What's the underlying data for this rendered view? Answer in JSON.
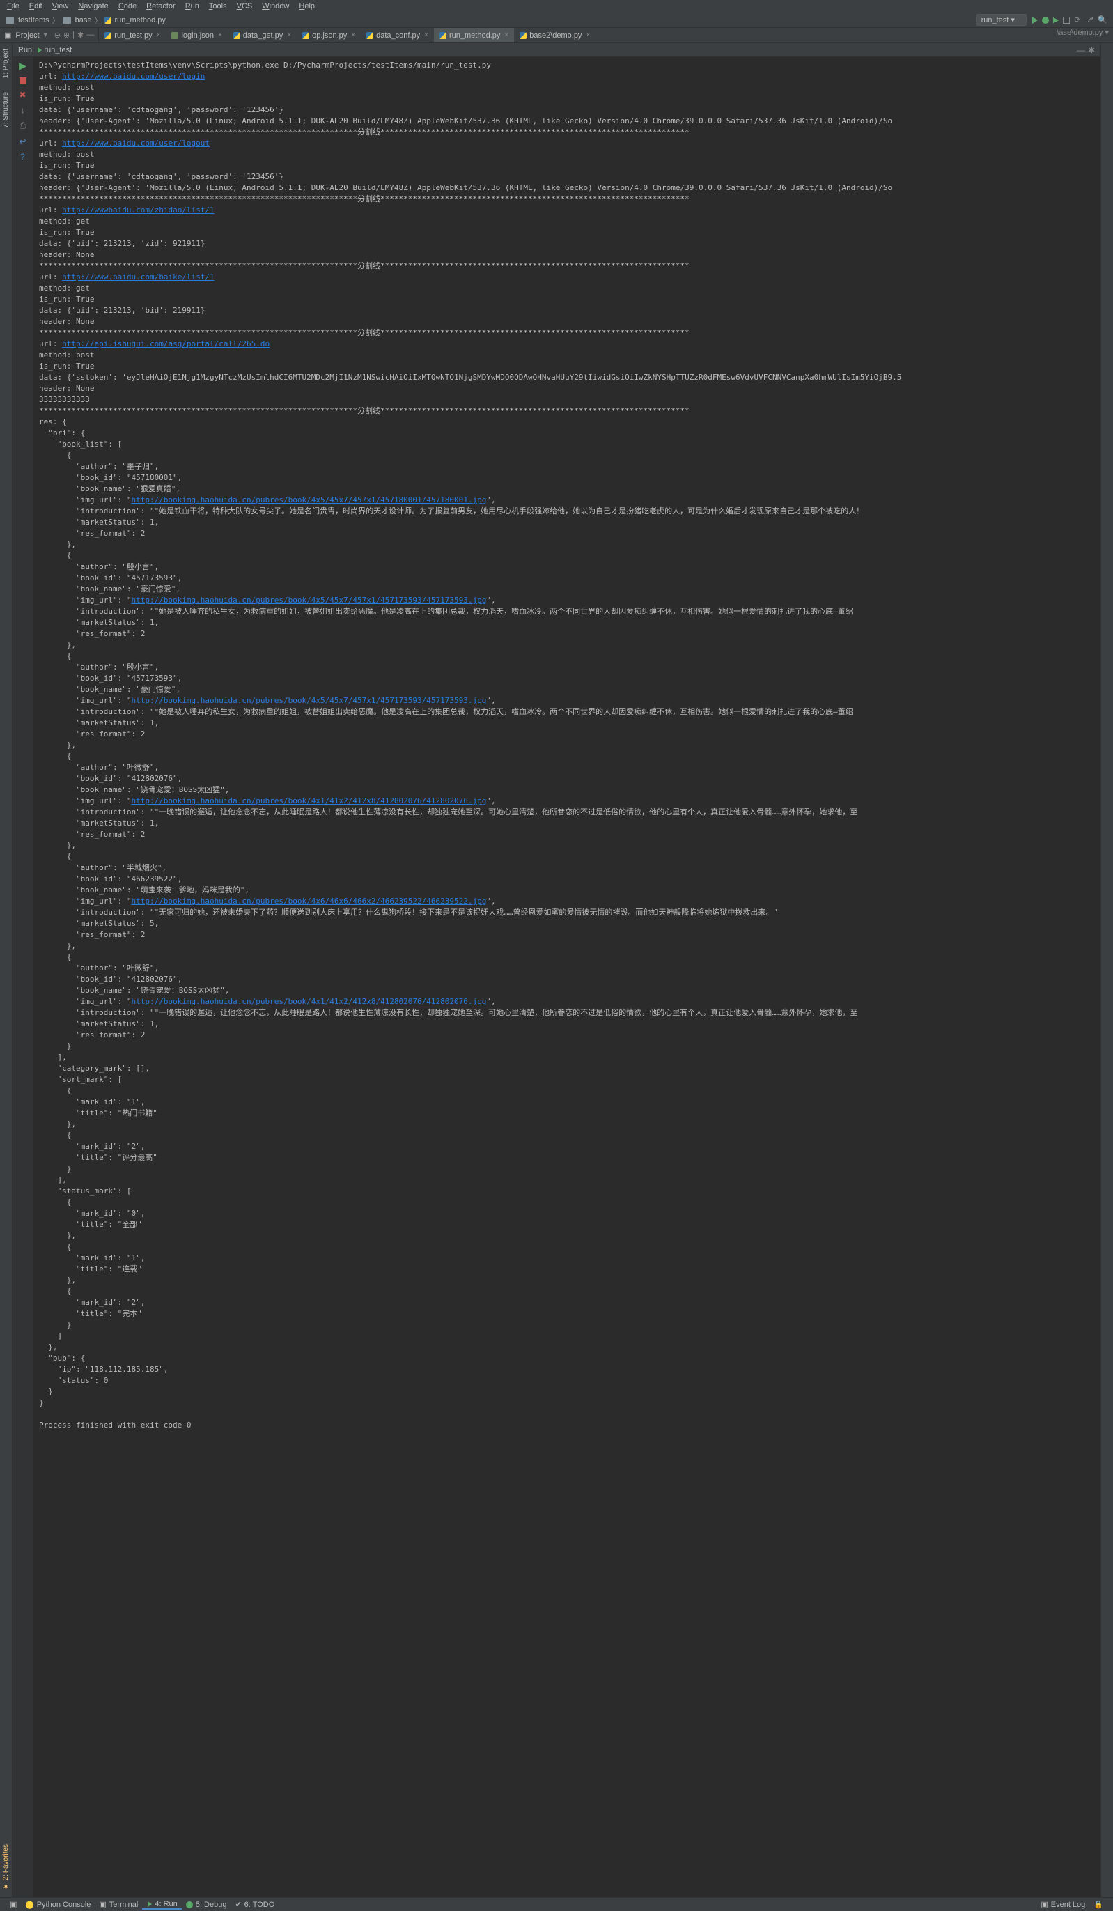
{
  "menu": [
    "File",
    "Edit",
    "View",
    "Navigate",
    "Code",
    "Refactor",
    "Run",
    "Tools",
    "VCS",
    "Window",
    "Help"
  ],
  "breadcrumb": {
    "root": "testItems",
    "folder": "base",
    "file": "run_method.py"
  },
  "runConfig": "run_test",
  "navPath": "\\ase\\demo.py",
  "sideTools": {
    "project": "1: Project",
    "structure": "7: Structure",
    "favorites": "2: Favorites"
  },
  "projHeader": "Project",
  "tabs": [
    {
      "type": "py",
      "name": "run_test.py",
      "close": true
    },
    {
      "type": "json",
      "name": "login.json",
      "close": true
    },
    {
      "type": "py",
      "name": "data_get.py",
      "close": true
    },
    {
      "type": "py",
      "name": "op.json.py",
      "close": true
    },
    {
      "type": "py",
      "name": "data_conf.py",
      "close": true
    },
    {
      "type": "py",
      "name": "run_method.py",
      "close": true,
      "active": true
    },
    {
      "type": "py",
      "name": "base2\\demo.py",
      "close": true
    }
  ],
  "runPanel": {
    "title": "Run:",
    "name": "run_test"
  },
  "exec": "D:\\PycharmProjects\\testItems\\venv\\Scripts\\python.exe D:/PycharmProjects/testItems/main/run_test.py",
  "sep": "*********************************************************************分割线*******************************************************************",
  "blocks": [
    {
      "url": "http://www.baidu.com/user/login",
      "method": "post",
      "is_run": "True",
      "data": "{'username': 'cdtaogang', 'password': '123456'}",
      "header": "{'User-Agent': 'Mozilla/5.0 (Linux; Android 5.1.1; DUK-AL20 Build/LMY48Z) AppleWebKit/537.36 (KHTML, like Gecko) Version/4.0 Chrome/39.0.0.0 Safari/537.36 JsKit/1.0 (Android)/So"
    },
    {
      "url": "http://www.baidu.com/user/logout",
      "method": "post",
      "is_run": "True",
      "data": "{'username': 'cdtaogang', 'password': '123456'}",
      "header": "{'User-Agent': 'Mozilla/5.0 (Linux; Android 5.1.1; DUK-AL20 Build/LMY48Z) AppleWebKit/537.36 (KHTML, like Gecko) Version/4.0 Chrome/39.0.0.0 Safari/537.36 JsKit/1.0 (Android)/So"
    },
    {
      "url": "http://wwwbaidu.com/zhidao/list/1",
      "method": "get",
      "is_run": "True",
      "data": "{'uid': 213213, 'zid': 921911}",
      "header": "None"
    },
    {
      "url": "http://www.baidu.com/baike/list/1",
      "method": "get",
      "is_run": "True",
      "data": "{'uid': 213213, 'bid': 219911}",
      "header": "None"
    },
    {
      "url": "http://api.ishugui.com/asg/portal/call/265.do",
      "method": "post",
      "is_run": "True",
      "data": "{'sstoken': 'eyJleHAiOjE1Njg1MzgyNTczMzUsImlhdCI6MTU2MDc2MjI1NzM1NSwicHAiOiIxMTQwNTQ1NjgSMDYwMDQ0ODAwQHNvaHUuY29tIiwidGsiOiIwZkNYSHpTTUZzR0dFMEsw6VdvUVFCNNVCanpXa0hmWUlIsIm5YiOjB9.5",
      "header": "None",
      "extra": "33333333333"
    }
  ],
  "resHeader": "res: {",
  "books": [
    {
      "author": "墨子归",
      "book_id": "457180001",
      "book_name": "狠爱真婚",
      "img_url": "http://bookimg.haohuida.cn/pubres/book/4x5/45x7/457x1/457180001/457180001.jpg",
      "introduction": "\"她是铁血干将，特种大队的女号尖子。她是名门贵胄，时尚界的天才设计师。为了报复前男友，她用尽心机手段强嫁给他，她以为自己才是扮猪吃老虎的人，可是为什么婚后才发现原来自己才是那个被吃的人！",
      "marketStatus": 1,
      "res_format": 2
    },
    {
      "author": "殷小言",
      "book_id": "457173593",
      "book_name": "豪门惊爱",
      "img_url": "http://bookimg.haohuida.cn/pubres/book/4x5/45x7/457x1/457173593/457173593.jpg",
      "introduction": "\"她是被人唾弃的私生女，为救病重的姐姐，被替姐姐出卖给恶魔。他是凌高在上的集团总裁，权力滔天，嗜血冰冷。两个不同世界的人却因爱痴纠缠不休，互相伤害。她似一根爱情的刺扎进了我的心底—董绍",
      "marketStatus": 1,
      "res_format": 2
    },
    {
      "author": "殷小言",
      "book_id": "457173593",
      "book_name": "豪门惊爱",
      "img_url": "http://bookimg.haohuida.cn/pubres/book/4x5/45x7/457x1/457173593/457173593.jpg",
      "introduction": "\"她是被人唾弃的私生女，为救病重的姐姐，被替姐姐出卖给恶魔。他是凌高在上的集团总裁，权力滔天，嗜血冰冷。两个不同世界的人却因爱痴纠缠不休，互相伤害。她似一根爱情的刺扎进了我的心底—董绍",
      "marketStatus": 1,
      "res_format": 2
    },
    {
      "author": "叶微舒",
      "book_id": "412802076",
      "book_name": "饶骨宠爱：BOSS太凶猛",
      "img_url": "http://bookimg.haohuida.cn/pubres/book/4x1/41x2/412x8/412802076/412802076.jpg",
      "introduction": "\"一晚错误的邂逅，让他念念不忘，从此睡眠是路人！都说他生性薄凉没有长性，却独独宠她至深。可她心里清楚，他所眷恋的不过是低俗的情欲，他的心里有个人，真正让他爱入骨髓……意外怀孕，她求他，至",
      "marketStatus": 1,
      "res_format": 2
    },
    {
      "author": "半城烟火",
      "book_id": "466239522",
      "book_name": "萌宝来袭：爹地，妈咪是我的",
      "img_url": "http://bookimg.haohuida.cn/pubres/book/4x6/46x6/466x2/466239522/466239522.jpg",
      "introduction": "\"无家可归的她，还被未婚夫下了药？顺便送到别人床上享用？什么鬼狗桥段！接下来是不是该捉奸大戏……曾经恩爱如蜜的爱情被无情的摧毁。而他如天神般降临将她炼狱中拨救出来。\"",
      "marketStatus": 5,
      "res_format": 2
    },
    {
      "author": "叶微舒",
      "book_id": "412802076",
      "book_name": "饶骨宠爱：BOSS太凶猛",
      "img_url": "http://bookimg.haohuida.cn/pubres/book/4x1/41x2/412x8/412802076/412802076.jpg",
      "introduction": "\"一晚错误的邂逅，让他念念不忘，从此睡眠是路人！都说他生性薄凉没有长性，却独独宠她至深。可她心里清楚，他所眷恋的不过是低俗的情欲，他的心里有个人，真正让他爱入骨髓……意外怀孕，她求他，至",
      "marketStatus": 1,
      "res_format": 2
    }
  ],
  "tail": {
    "category_mark": "[]",
    "sort_mark": [
      {
        "mark_id": "1",
        "title": "热门书籍"
      },
      {
        "mark_id": "2",
        "title": "评分最高"
      }
    ],
    "status_mark": [
      {
        "mark_id": "0",
        "title": "全部"
      },
      {
        "mark_id": "1",
        "title": "连载"
      },
      {
        "mark_id": "2",
        "title": "完本"
      }
    ],
    "pub": {
      "ip": "118.112.185.185",
      "status": 0
    },
    "exit": "Process finished with exit code 0"
  },
  "status": {
    "pythonConsole": "Python Console",
    "terminal": "Terminal",
    "run": "4: Run",
    "debug": "5: Debug",
    "todo": "6: TODO",
    "eventLog": "Event Log"
  }
}
